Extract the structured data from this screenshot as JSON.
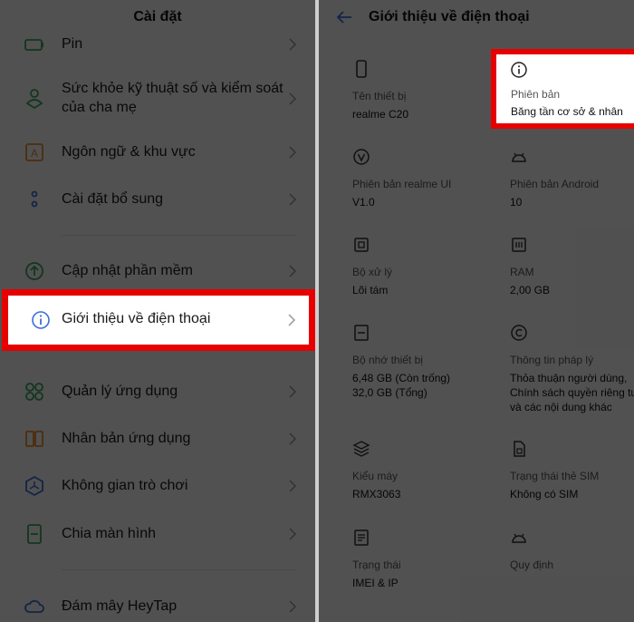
{
  "left": {
    "title": "Cài đặt",
    "items": [
      {
        "label": "Pin",
        "icon": "battery-icon"
      },
      {
        "label": "Sức khỏe kỹ thuật số và kiểm soát của cha mẹ",
        "icon": "digital-wellbeing-icon"
      },
      {
        "label": "Ngôn ngữ & khu vực",
        "icon": "language-icon"
      },
      {
        "label": "Cài đặt bổ sung",
        "icon": "additional-settings-icon"
      },
      {
        "label": "Cập nhật phần mềm",
        "icon": "software-update-icon"
      },
      {
        "label": "Giới thiệu về điện thoại",
        "icon": "info-icon"
      },
      {
        "label": "Quản lý ứng dụng",
        "icon": "app-management-icon"
      },
      {
        "label": "Nhân bản ứng dụng",
        "icon": "app-clone-icon"
      },
      {
        "label": "Không gian trò chơi",
        "icon": "game-space-icon"
      },
      {
        "label": "Chia màn hình",
        "icon": "split-screen-icon"
      },
      {
        "label": "Đám mây HeyTap",
        "icon": "cloud-icon"
      }
    ]
  },
  "right": {
    "title": "Giới thiệu về điện thoại",
    "cells": [
      {
        "label": "Tên thiết bị",
        "value": "realme C20",
        "icon": "phone-icon"
      },
      {
        "label": "Phiên bản",
        "value": "Băng tần cơ sở & nhân",
        "icon": "info-icon"
      },
      {
        "label": "Phiên bản realme UI",
        "value": "V1.0",
        "icon": "realme-ui-icon"
      },
      {
        "label": "Phiên bản Android",
        "value": "10",
        "icon": "android-icon"
      },
      {
        "label": "Bộ xử lý",
        "value": "Lõi tám",
        "icon": "processor-icon"
      },
      {
        "label": "RAM",
        "value": "2,00 GB",
        "icon": "ram-icon"
      },
      {
        "label": "Bộ nhớ thiết bị",
        "value": "6,48 GB (Còn trống)",
        "value2": "32,0 GB (Tổng)",
        "icon": "storage-icon"
      },
      {
        "label": "Thông tin pháp lý",
        "value": "Thỏa thuận người dùng,",
        "value2": "Chính sách quyền riêng tư",
        "value3": "và các nội dung khác",
        "icon": "copyright-icon"
      },
      {
        "label": "Kiểu máy",
        "value": "RMX3063",
        "icon": "layers-icon"
      },
      {
        "label": "Trạng thái thẻ SIM",
        "value": "Không có SIM",
        "icon": "sim-card-icon"
      },
      {
        "label": "Trạng thái",
        "value": "IMEI & IP",
        "icon": "status-icon"
      },
      {
        "label": "Quy định",
        "icon": "android-icon"
      }
    ]
  },
  "colors": {
    "highlight": "#e60000",
    "accent": "#3a6fd8",
    "dim_overlay": "rgba(0,0,0,0.67)"
  }
}
